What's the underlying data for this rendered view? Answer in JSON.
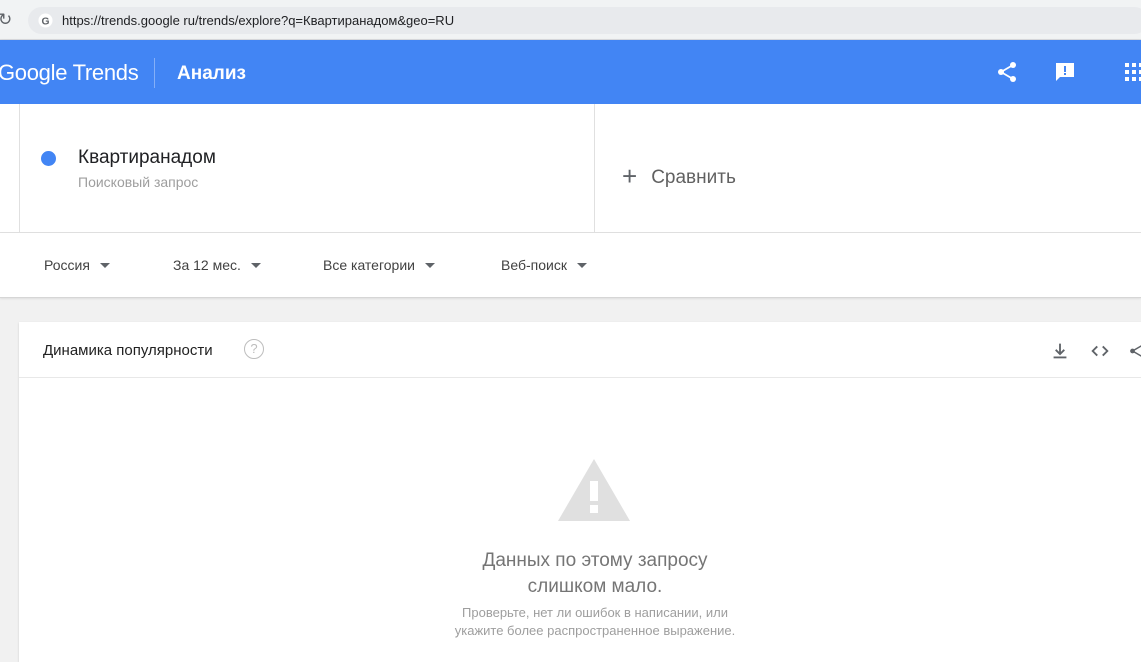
{
  "browser": {
    "url": "https://trends.google ru/trends/explore?q=Квартиранадом&geo=RU"
  },
  "header": {
    "logo_google": "Google",
    "logo_trends": "Trends",
    "title": "Анализ",
    "icons": [
      "share-icon",
      "feedback-icon",
      "apps-icon"
    ]
  },
  "term": {
    "name": "Квартиранадом",
    "type": "Поисковый запрос",
    "color": "#4285f4"
  },
  "compare": {
    "plus": "+",
    "label": "Сравнить"
  },
  "filters": {
    "region": "Россия",
    "period": "За 12 мес.",
    "category": "Все категории",
    "search_type": "Веб-поиск"
  },
  "card": {
    "title": "Динамика популярности",
    "help": "?",
    "message_line1": "Данных по этому запросу",
    "message_line2": "слишком мало.",
    "hint_line1": "Проверьте, нет ли ошибок в написании, или",
    "hint_line2": "укажите более распространенное выражение."
  },
  "colors": {
    "brand": "#4285f4",
    "warning": "#e0e0e0"
  }
}
